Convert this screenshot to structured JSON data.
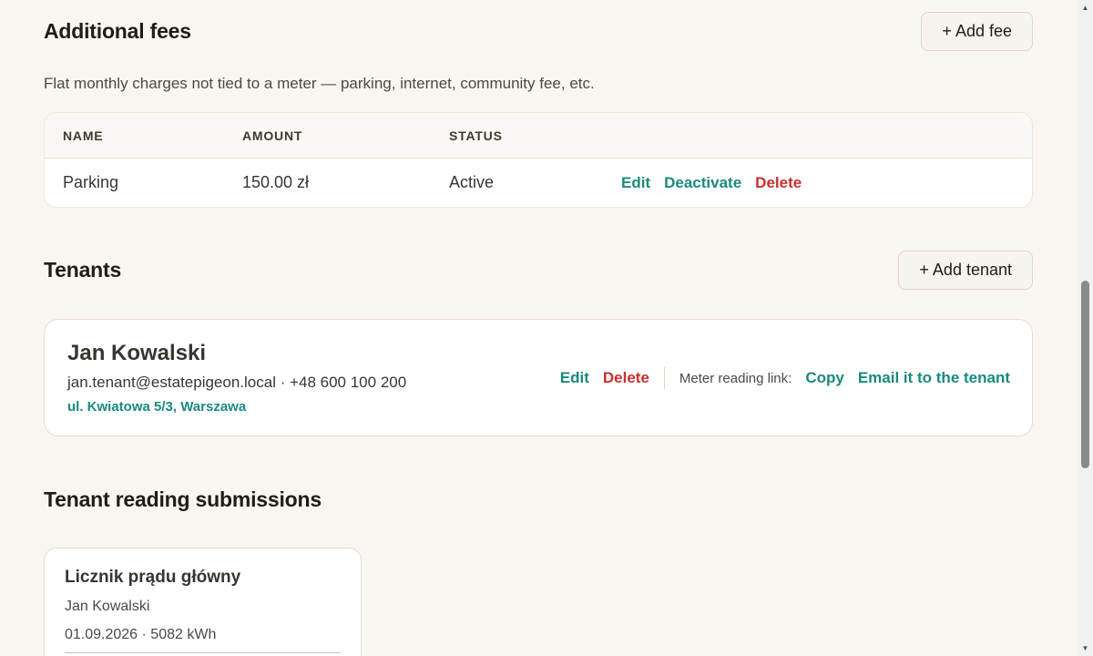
{
  "fees": {
    "title": "Additional fees",
    "add_button": "+ Add fee",
    "description": "Flat monthly charges not tied to a meter — parking, internet, community fee, etc.",
    "columns": {
      "name": "NAME",
      "amount": "AMOUNT",
      "status": "STATUS"
    },
    "rows": [
      {
        "name": "Parking",
        "amount": "150.00 zł",
        "status": "Active",
        "edit": "Edit",
        "deactivate": "Deactivate",
        "delete": "Delete"
      }
    ]
  },
  "tenants": {
    "title": "Tenants",
    "add_button": "+ Add tenant",
    "items": [
      {
        "name": "Jan Kowalski",
        "contact": "jan.tenant@estatepigeon.local · +48 600 100 200",
        "address": "ul. Kwiatowa 5/3, Warszawa",
        "edit": "Edit",
        "delete": "Delete",
        "meter_link_label": "Meter reading link:",
        "copy": "Copy",
        "email": "Email it to the tenant"
      }
    ]
  },
  "submissions": {
    "title": "Tenant reading submissions",
    "items": [
      {
        "meter": "Licznik prądu główny",
        "tenant": "Jan Kowalski",
        "reading": "01.09.2026 · 5082 kWh"
      }
    ]
  },
  "colors": {
    "accent": "#1a8a7c",
    "danger": "#c9302c",
    "background": "#f9f6f1"
  }
}
